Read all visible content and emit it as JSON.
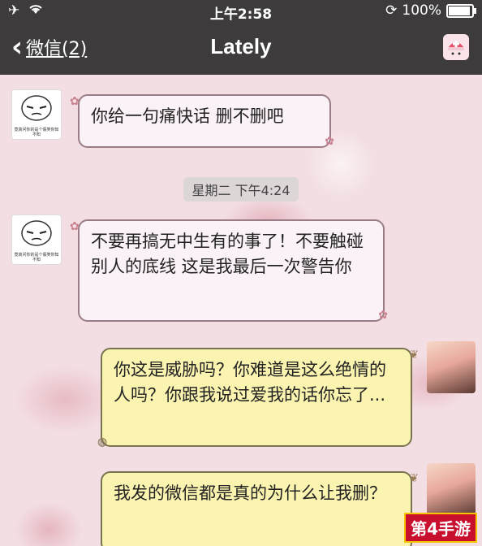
{
  "status_bar": {
    "time": "上午2:58",
    "battery": "100%"
  },
  "nav": {
    "back_label": "微信(2)",
    "title": "Lately"
  },
  "avatar_caption": "竟真问你的是个假笑你知不知",
  "messages": [
    {
      "side": "left",
      "text": "你给一句痛快话 删不删吧"
    },
    {
      "side": "left",
      "text": "不要再搞无中生有的事了！不要触碰别人的底线 这是我最后一次警告你"
    },
    {
      "side": "right",
      "text": "你这是威胁吗？你难道是这么绝情的人吗？你跟我说过爱我的话你忘了..."
    },
    {
      "side": "right",
      "text": "我发的微信都是真的为什么让我删？"
    }
  ],
  "timestamp": "星期二 下午4:24",
  "watermark": "第4手游"
}
